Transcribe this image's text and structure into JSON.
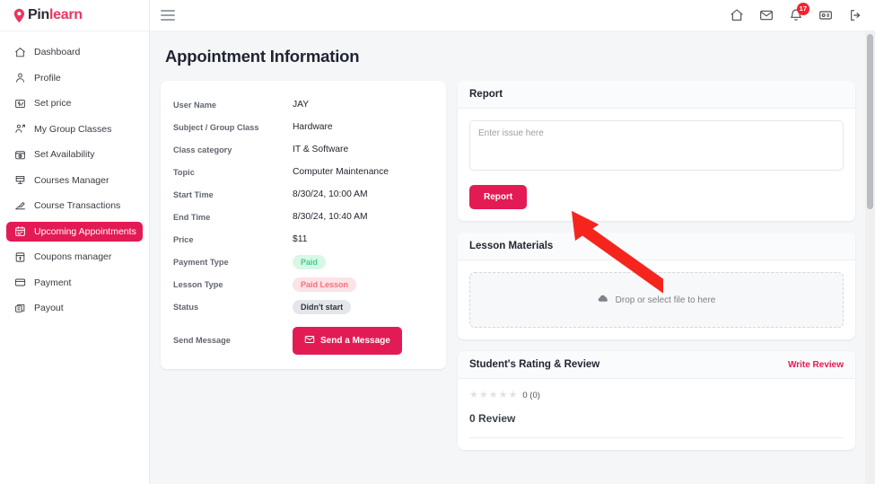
{
  "brand": {
    "logo_first": "Pin",
    "logo_second": "learn",
    "accent_color": "#e31b54",
    "logo_pin_color": "#e8365d"
  },
  "sidebar": {
    "items": [
      {
        "label": "Dashboard",
        "icon": "home-icon",
        "active": false
      },
      {
        "label": "Profile",
        "icon": "user-icon",
        "active": false
      },
      {
        "label": "Set price",
        "icon": "price-tag-icon",
        "active": false
      },
      {
        "label": "My Group Classes",
        "icon": "group-class-icon",
        "active": false
      },
      {
        "label": "Set Availability",
        "icon": "calendar-clock-icon",
        "active": false
      },
      {
        "label": "Courses Manager",
        "icon": "courses-icon",
        "active": false
      },
      {
        "label": "Course Transactions",
        "icon": "transactions-icon",
        "active": false
      },
      {
        "label": "Upcoming Appointments",
        "icon": "calendar-icon",
        "active": true
      },
      {
        "label": "Coupons manager",
        "icon": "coupon-icon",
        "active": false
      },
      {
        "label": "Payment",
        "icon": "card-icon",
        "active": false
      },
      {
        "label": "Payout",
        "icon": "payout-icon",
        "active": false
      }
    ]
  },
  "topbar": {
    "menu_icon": "hamburger-icon",
    "icons": [
      {
        "name": "home-icon",
        "badge": null
      },
      {
        "name": "mail-icon",
        "badge": null
      },
      {
        "name": "bell-icon",
        "badge": "17"
      },
      {
        "name": "id-card-icon",
        "badge": null
      },
      {
        "name": "logout-icon",
        "badge": null
      }
    ]
  },
  "page": {
    "title": "Appointment Information"
  },
  "appointment": {
    "rows": [
      {
        "label": "User Name",
        "value": "JAY",
        "type": "text"
      },
      {
        "label": "Subject / Group Class",
        "value": "Hardware",
        "type": "text"
      },
      {
        "label": "Class category",
        "value": "IT & Software",
        "type": "text"
      },
      {
        "label": "Topic",
        "value": "Computer Maintenance",
        "type": "text"
      },
      {
        "label": "Start Time",
        "value": "8/30/24, 10:00 AM",
        "type": "text"
      },
      {
        "label": "End Time",
        "value": "8/30/24, 10:40 AM",
        "type": "text"
      },
      {
        "label": "Price",
        "value": "$11",
        "type": "text"
      },
      {
        "label": "Payment Type",
        "value": "Paid",
        "type": "pill-paid"
      },
      {
        "label": "Lesson Type",
        "value": "Paid Lesson",
        "type": "pill-lesson"
      },
      {
        "label": "Status",
        "value": "Didn't start",
        "type": "pill-status"
      },
      {
        "label": "Send Message",
        "value": "Send a Message",
        "type": "button"
      }
    ]
  },
  "report": {
    "title": "Report",
    "placeholder": "Enter issue here",
    "value": "",
    "button_label": "Report"
  },
  "lesson_materials": {
    "title": "Lesson Materials",
    "dropzone_text": "Drop or select file to here",
    "dropzone_icon": "cloud-upload-icon"
  },
  "rating": {
    "title": "Student's Rating & Review",
    "write_review_label": "Write Review",
    "stars_total": 5,
    "stars_filled": 0,
    "score_text": "0 (0)",
    "review_count_text": "0 Review"
  },
  "annotation": {
    "type": "arrow",
    "color": "#f5251e",
    "points_at": "report-button"
  }
}
